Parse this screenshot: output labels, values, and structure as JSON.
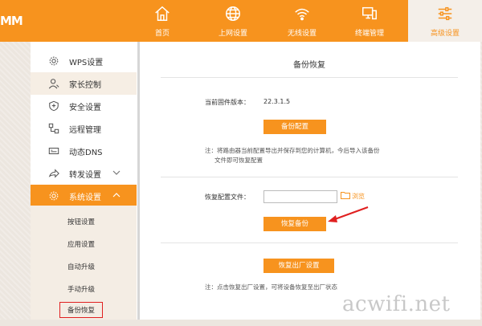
{
  "header": {
    "logo": "MM",
    "nav": [
      {
        "label": "首页",
        "icon": "home-icon"
      },
      {
        "label": "上网设置",
        "icon": "globe-icon"
      },
      {
        "label": "无线设置",
        "icon": "wifi-icon"
      },
      {
        "label": "终端管理",
        "icon": "devices-icon"
      },
      {
        "label": "高级设置",
        "icon": "sliders-icon",
        "active": true
      }
    ]
  },
  "sidebar": {
    "items": [
      {
        "label": "WPS设置",
        "icon": "gear-icon"
      },
      {
        "label": "家长控制",
        "icon": "user-icon"
      },
      {
        "label": "安全设置",
        "icon": "shield-icon"
      },
      {
        "label": "远程管理",
        "icon": "remote-icon"
      },
      {
        "label": "动态DNS",
        "icon": "dns-icon"
      },
      {
        "label": "转发设置",
        "icon": "forward-icon"
      },
      {
        "label": "系统设置",
        "icon": "gear-icon"
      }
    ],
    "sub_items": [
      "按钮设置",
      "应用设置",
      "自动升级",
      "手动升级",
      "备份恢复"
    ]
  },
  "main": {
    "title": "备份恢复",
    "firmware_label": "当前固件版本：",
    "firmware_version": "22.3.1.5",
    "backup_button": "备份配置",
    "backup_note_line1": "注：将路由器当前配置导出并保存到您的计算机，今后导入该备份",
    "backup_note_line2": "文件即可恢复配置",
    "restore_file_label": "恢复配置文件：",
    "browse_label": "浏览",
    "restore_button": "恢复备份",
    "factory_button": "恢复出厂设置",
    "factory_note": "注：点击恢复出厂设置，可将设备恢复至出厂状态"
  },
  "watermark": "acwifi.net",
  "colors": {
    "accent": "#f7931e",
    "highlight_box": "#e02020",
    "arrow": "#e02020"
  }
}
